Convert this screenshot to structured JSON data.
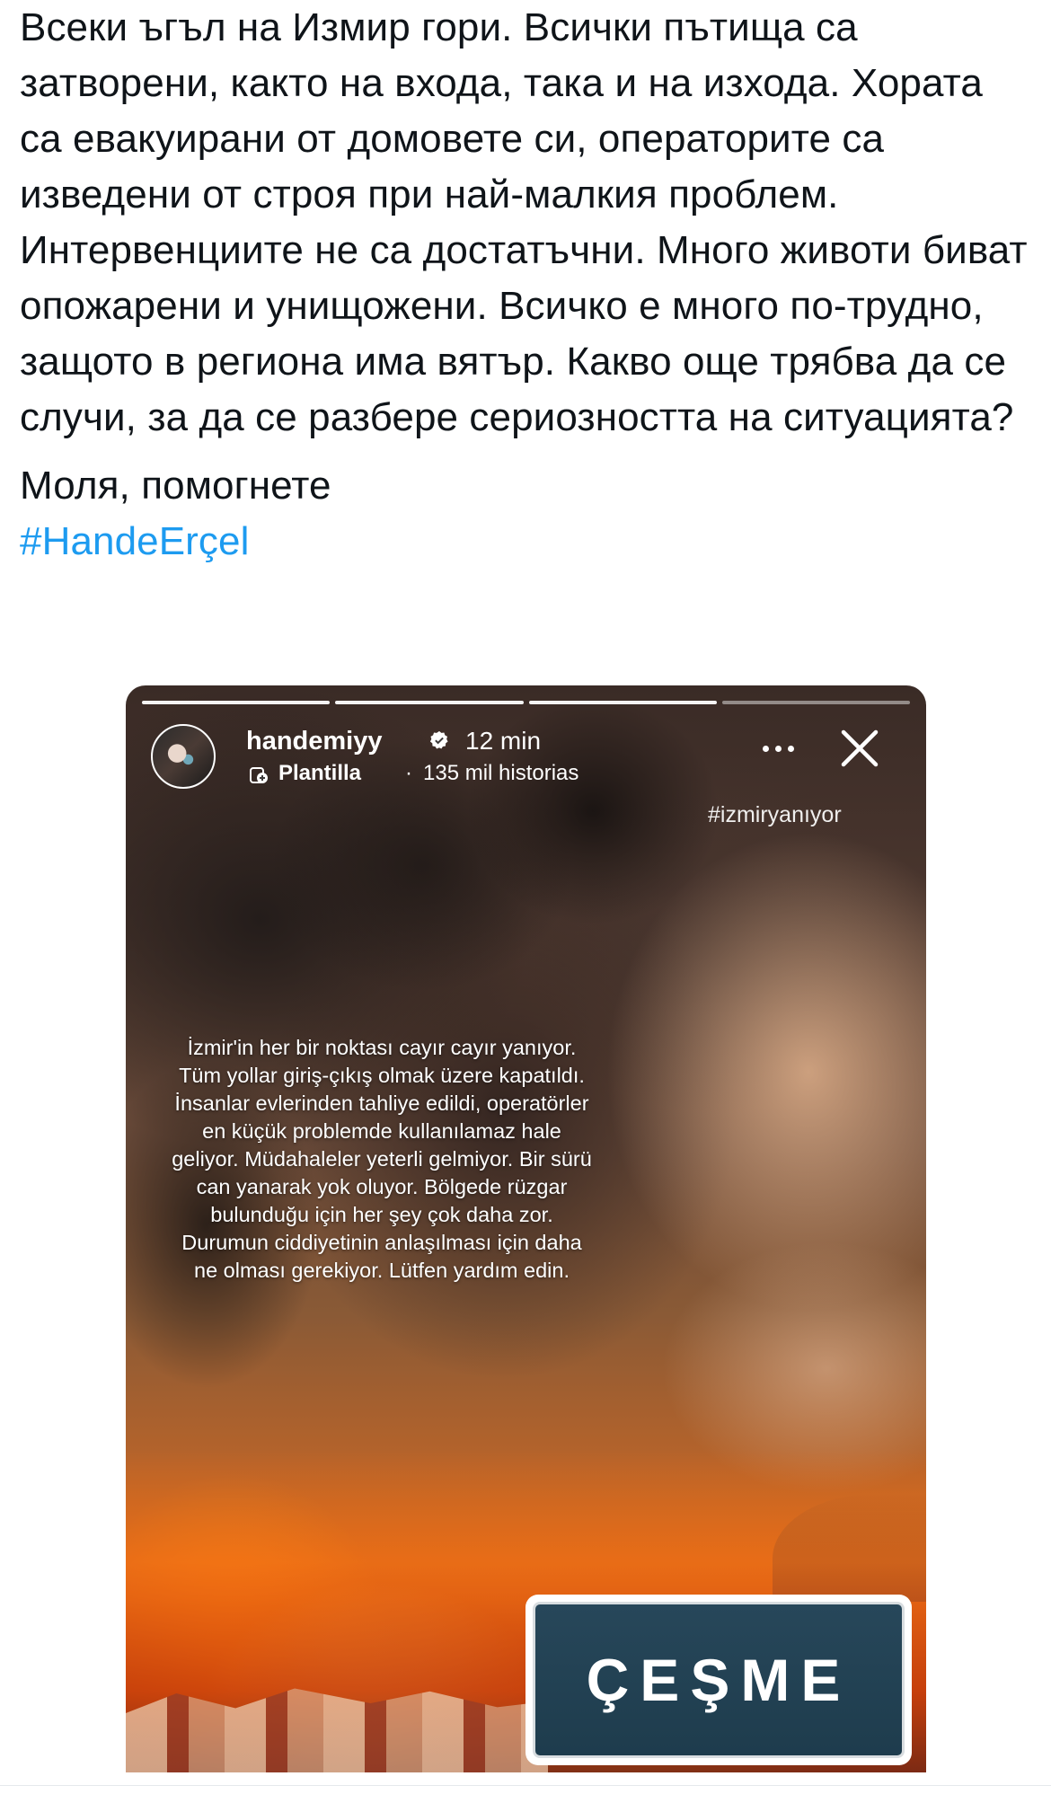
{
  "tweet": {
    "body": "Всеки ъгъл на Измир гори. Всички пътища са затворени, както на входа, така и на изхода. Хората са евакуирани от домовете си, операторите са изведени от строя при най-малкия проблем. Интервенциите не са достатъчни. Много животи биват опожарени и унищожени. Всичко е много по-трудно, защото в региона има вятър. Какво още трябва да се случи, за да се разбере сериозността на ситуацията?",
    "plea": "Моля, помогнете",
    "hashtag": "#HandeErçel",
    "hashtag_color": "#1d9bf0"
  },
  "story": {
    "progress_segments": 4,
    "segments_done": 3,
    "username": "handemiyy",
    "time": "12 min",
    "template_label": "Plantilla",
    "separator": "·",
    "template_count": "135 mil historias",
    "hashtag": "#izmiryanıyor",
    "caption": "İzmir'in her bir noktası cayır cayır yanıyor. Tüm yollar giriş-çıkış olmak üzere kapatıldı. İnsanlar evlerinden tahliye edildi, operatörler en küçük problemde kullanılamaz hale geliyor. Müdahaleler yeterli gelmiyor. Bir sürü can yanarak yok oluyor. Bölgede rüzgar bulunduğu için her şey çok daha zor. Durumun ciddiyetinin anlaşılması için daha ne olması gerekiyor. Lütfen yardım edin.",
    "sign_text": "ÇEŞME",
    "icons": [
      "verified-badge-icon",
      "template-icon",
      "more-options-icon",
      "close-icon"
    ]
  }
}
